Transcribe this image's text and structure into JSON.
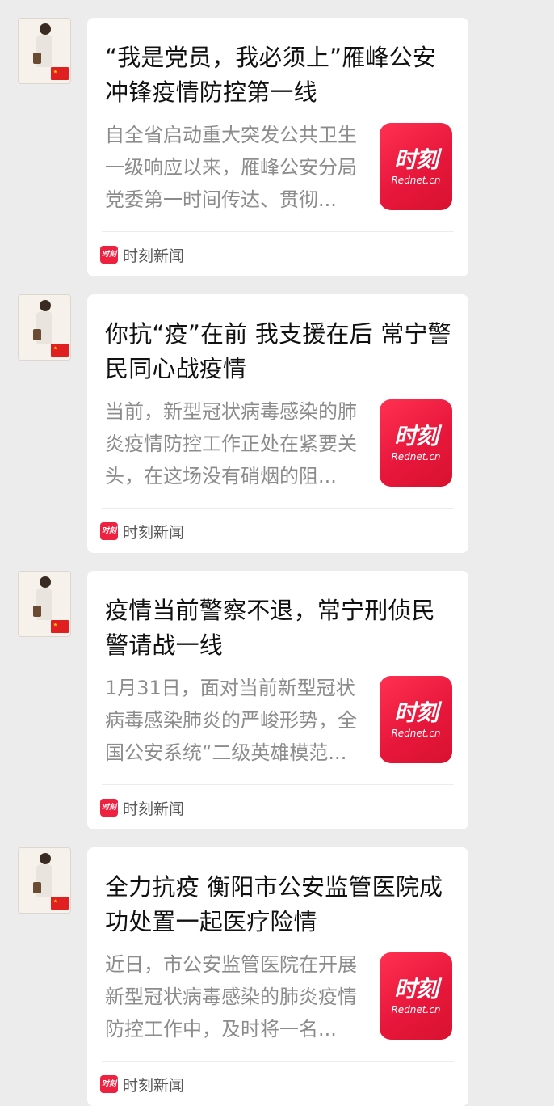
{
  "messages": [
    {
      "title": "“我是党员，我必须上”雁峰公安冲锋疫情防控第一线",
      "summary": "自全省启动重大突发公共卫生一级响应以来，雁峰公安分局党委第一时间传达、贯彻...",
      "thumbnail": {
        "brand": "时刻",
        "sub": "Rednet.cn"
      },
      "source": "时刻新闻"
    },
    {
      "title": "你抗“疫”在前 我支援在后 常宁警民同心战疫情",
      "summary": "当前，新型冠状病毒感染的肺炎疫情防控工作正处在紧要关头，在这场没有硝烟的阻...",
      "thumbnail": {
        "brand": "时刻",
        "sub": "Rednet.cn"
      },
      "source": "时刻新闻"
    },
    {
      "title": "疫情当前警察不退，常宁刑侦民警请战一线",
      "summary": "1月31日，面对当前新型冠状病毒感染肺炎的严峻形势，全国公安系统“二级英雄模范...",
      "thumbnail": {
        "brand": "时刻",
        "sub": "Rednet.cn"
      },
      "source": "时刻新闻"
    },
    {
      "title": "全力抗疫 衡阳市公安监管医院成功处置一起医疗险情",
      "summary": "近日，市公安监管医院在开展新型冠状病毒感染的肺炎疫情防控工作中，及时将一名...",
      "thumbnail": {
        "brand": "时刻",
        "sub": "Rednet.cn"
      },
      "source": "时刻新闻"
    }
  ],
  "colors": {
    "background": "#ececec",
    "card": "#ffffff",
    "brand_red": "#e8173c",
    "title": "#111111",
    "summary": "#8c8c8c"
  },
  "icons": {
    "avatar": "avatar-image",
    "thumbnail": "shike-logo-thumbnail",
    "source": "shike-news-icon"
  }
}
